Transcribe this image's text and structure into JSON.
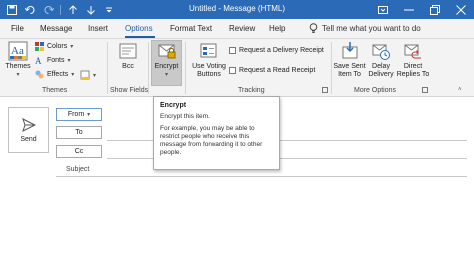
{
  "window": {
    "title": "Untitled - Message (HTML)",
    "controls": [
      "ribbon-display",
      "minimize",
      "restore",
      "close"
    ]
  },
  "quick_access": [
    "save-icon",
    "undo-icon",
    "redo-icon",
    "up-icon",
    "down-icon",
    "customize-icon"
  ],
  "tabs": [
    {
      "label": "File"
    },
    {
      "label": "Message"
    },
    {
      "label": "Insert"
    },
    {
      "label": "Options",
      "active": true
    },
    {
      "label": "Format Text"
    },
    {
      "label": "Review"
    },
    {
      "label": "Help"
    }
  ],
  "tell_me": {
    "label": "Tell me what you want to do",
    "icon": "lightbulb-icon"
  },
  "ribbon": {
    "themes": {
      "themes_label": "Themes",
      "colors_label": "Colors",
      "fonts_label": "Fonts",
      "effects_label": "Effects",
      "page_color_label": "Page Color",
      "group_label": "Themes"
    },
    "show_fields": {
      "bcc_label": "Bcc",
      "group_label": "Show Fields"
    },
    "encrypt": {
      "encrypt_label": "Encrypt",
      "group_label": "Encrypt"
    },
    "tracking": {
      "voting_label_1": "Use Voting",
      "voting_label_2": "Buttons",
      "delivery_receipt_label": "Request a Delivery Receipt",
      "read_receipt_label": "Request a Read Receipt",
      "group_label": "Tracking"
    },
    "more_options": {
      "save_sent_1": "Save Sent",
      "save_sent_2": "Item To",
      "delay_1": "Delay",
      "delay_2": "Delivery",
      "direct_1": "Direct",
      "direct_2": "Replies To",
      "group_label": "More Options"
    }
  },
  "compose": {
    "send_label": "Send",
    "from_label": "From",
    "to_label": "To",
    "cc_label": "Cc",
    "subject_label": "Subject"
  },
  "tooltip": {
    "title": "Encrypt",
    "line1": "Encrypt this item.",
    "line2": "For example, you may be able to restrict people who receive this message from forwarding it to other people."
  },
  "colors": {
    "title_bar": "#2b6ab6",
    "accent": "#1e5fa8",
    "ribbon_bg": "#f3f3f3"
  }
}
